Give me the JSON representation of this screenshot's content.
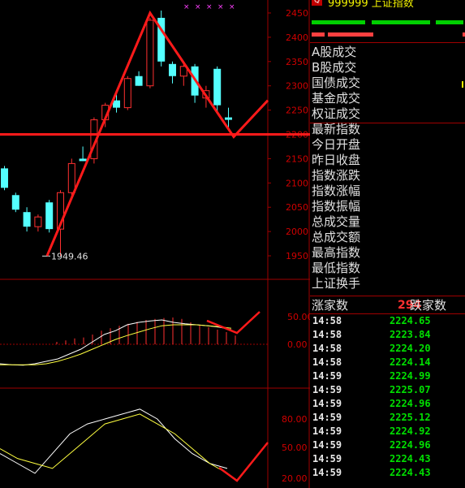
{
  "quote": {
    "code": "999999",
    "name": "上证指数",
    "code_box": "Q"
  },
  "price_axis": [
    2450,
    2400,
    2350,
    2300,
    2250,
    2200,
    2150,
    2100,
    2050,
    2000,
    1950
  ],
  "price_range": [
    1930,
    2460
  ],
  "low_label": "1949.46",
  "macd_axis": [
    "50.00",
    "0.00"
  ],
  "kdj_axis": [
    "80.00",
    "50.00",
    "20.00"
  ],
  "fields": [
    "A股成交",
    "B股成交",
    "国债成交",
    "基金成交",
    "权证成交",
    "最新指数",
    "今日开盘",
    "昨日收盘",
    "指数涨跌",
    "指数涨幅",
    "指数振幅",
    "总成交量",
    "总成交额",
    "最高指数",
    "最低指数",
    "上证换手"
  ],
  "advance_decline": {
    "rise_label": "涨家数",
    "fall_count": "294",
    "fall_label": "跌家数"
  },
  "ticks": [
    {
      "time": "14:58",
      "price": "2224.65"
    },
    {
      "time": "14:58",
      "price": "2223.84"
    },
    {
      "time": "14:58",
      "price": "2224.20"
    },
    {
      "time": "14:58",
      "price": "2224.14"
    },
    {
      "time": "14:59",
      "price": "2224.99"
    },
    {
      "time": "14:59",
      "price": "2225.07"
    },
    {
      "time": "14:59",
      "price": "2224.96"
    },
    {
      "time": "14:59",
      "price": "2225.12"
    },
    {
      "time": "14:59",
      "price": "2224.92"
    },
    {
      "time": "14:59",
      "price": "2224.96"
    },
    {
      "time": "14:59",
      "price": "2224.43"
    },
    {
      "time": "14:59",
      "price": "2224.43"
    }
  ],
  "colors": {
    "up": "#ff3030",
    "down": "#54ffff",
    "axis": "#a00000",
    "annotation": "#ff1a1a"
  },
  "chart_data": {
    "type": "candlestick",
    "candles": [
      {
        "o": 2130,
        "h": 2135,
        "l": 2085,
        "c": 2090
      },
      {
        "o": 2075,
        "h": 2080,
        "l": 2040,
        "c": 2045
      },
      {
        "o": 2040,
        "h": 2050,
        "l": 2000,
        "c": 2010
      },
      {
        "o": 2010,
        "h": 2035,
        "l": 2000,
        "c": 2030
      },
      {
        "o": 2060,
        "h": 2065,
        "l": 1998,
        "c": 2005
      },
      {
        "o": 2005,
        "h": 2085,
        "l": 1950,
        "c": 2080
      },
      {
        "o": 2080,
        "h": 2150,
        "l": 2075,
        "c": 2140
      },
      {
        "o": 2150,
        "h": 2175,
        "l": 2145,
        "c": 2145
      },
      {
        "o": 2150,
        "h": 2235,
        "l": 2140,
        "c": 2230
      },
      {
        "o": 2230,
        "h": 2265,
        "l": 2215,
        "c": 2260
      },
      {
        "o": 2270,
        "h": 2285,
        "l": 2245,
        "c": 2255
      },
      {
        "o": 2255,
        "h": 2320,
        "l": 2250,
        "c": 2315
      },
      {
        "o": 2320,
        "h": 2330,
        "l": 2300,
        "c": 2300
      },
      {
        "o": 2300,
        "h": 2440,
        "l": 2295,
        "c": 2435
      },
      {
        "o": 2440,
        "h": 2455,
        "l": 2340,
        "c": 2350
      },
      {
        "o": 2345,
        "h": 2350,
        "l": 2305,
        "c": 2320
      },
      {
        "o": 2320,
        "h": 2345,
        "l": 2300,
        "c": 2340
      },
      {
        "o": 2340,
        "h": 2345,
        "l": 2265,
        "c": 2280
      },
      {
        "o": 2275,
        "h": 2300,
        "l": 2255,
        "c": 2290
      },
      {
        "o": 2335,
        "h": 2340,
        "l": 2245,
        "c": 2260
      },
      {
        "o": 2235,
        "h": 2255,
        "l": 2210,
        "c": 2230
      }
    ],
    "support_level": 2200,
    "low_marker": 1949.46,
    "macd_bars": [
      5,
      8,
      12,
      14,
      20,
      28,
      33,
      38,
      42,
      46,
      50,
      52,
      54,
      55,
      52,
      45,
      40,
      35,
      30,
      25,
      18
    ],
    "macd_dif": [
      -40,
      -42,
      -43,
      -40,
      -35,
      -30,
      -20,
      -10,
      5,
      20,
      28,
      40,
      45,
      48,
      50,
      45,
      42,
      40,
      38,
      35,
      30
    ],
    "macd_dea": [
      -42,
      -42,
      -42,
      -42,
      -40,
      -35,
      -28,
      -20,
      -10,
      0,
      10,
      18,
      25,
      32,
      38,
      40,
      40,
      40,
      38,
      36,
      33
    ],
    "kdj_k": [
      45,
      35,
      25,
      45,
      65,
      75,
      80,
      85,
      90,
      80,
      60,
      45,
      35,
      30
    ],
    "kdj_d": [
      50,
      40,
      35,
      30,
      45,
      60,
      75,
      80,
      85,
      75,
      65,
      50,
      35,
      25
    ]
  }
}
